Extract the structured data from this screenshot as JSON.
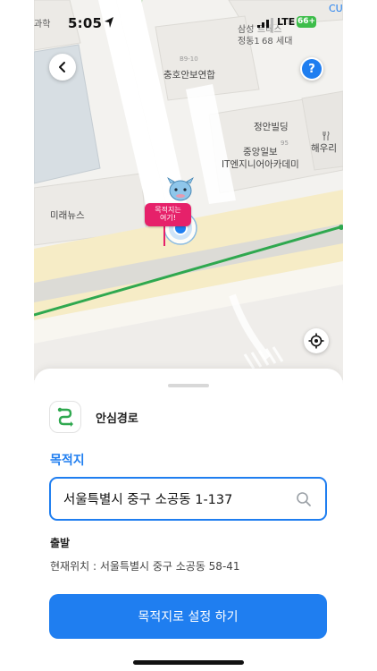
{
  "status_bar": {
    "time": "5:05",
    "network": "LTE",
    "battery": "66+"
  },
  "map": {
    "labels": {
      "top_left_fragment": "과학",
      "top_right_fragment": "CU",
      "building_1_line1": "삼성",
      "building_1_line2": "정동1",
      "building_1_line3": "세대",
      "building_1_overlay_line1": "트레스",
      "building_1_overlay_line2": "68",
      "lot_b9_10": "B9-10",
      "chungho": "충호안보연합",
      "jeongan": "정안빌딩",
      "lot_95": "95",
      "joongang_line1": "중앙일보",
      "joongang_line2": "IT엔지니어아카데미",
      "restaurant": "해우리",
      "miraenews": "미래뉴스",
      "destination_tag_line1": "목적지는",
      "destination_tag_line2": "여기!"
    }
  },
  "sheet": {
    "route_title": "안심경로",
    "destination_label": "목적지",
    "destination_value": "서울특별시 중구 소공동 1-137",
    "start_label": "출발",
    "start_value": "현재위치 : 서울특별시 중구 소공동 58-41",
    "cta_label": "목적지로 설정 하기"
  },
  "colors": {
    "accent": "#1f7ef0",
    "route_line": "#2fa84f",
    "marker_tag": "#e6216a",
    "battery": "#3dbd4a"
  },
  "icons": {
    "back": "chevron-left-icon",
    "help": "question-icon",
    "gps": "crosshair-icon",
    "route": "route-icon",
    "search": "search-icon"
  }
}
